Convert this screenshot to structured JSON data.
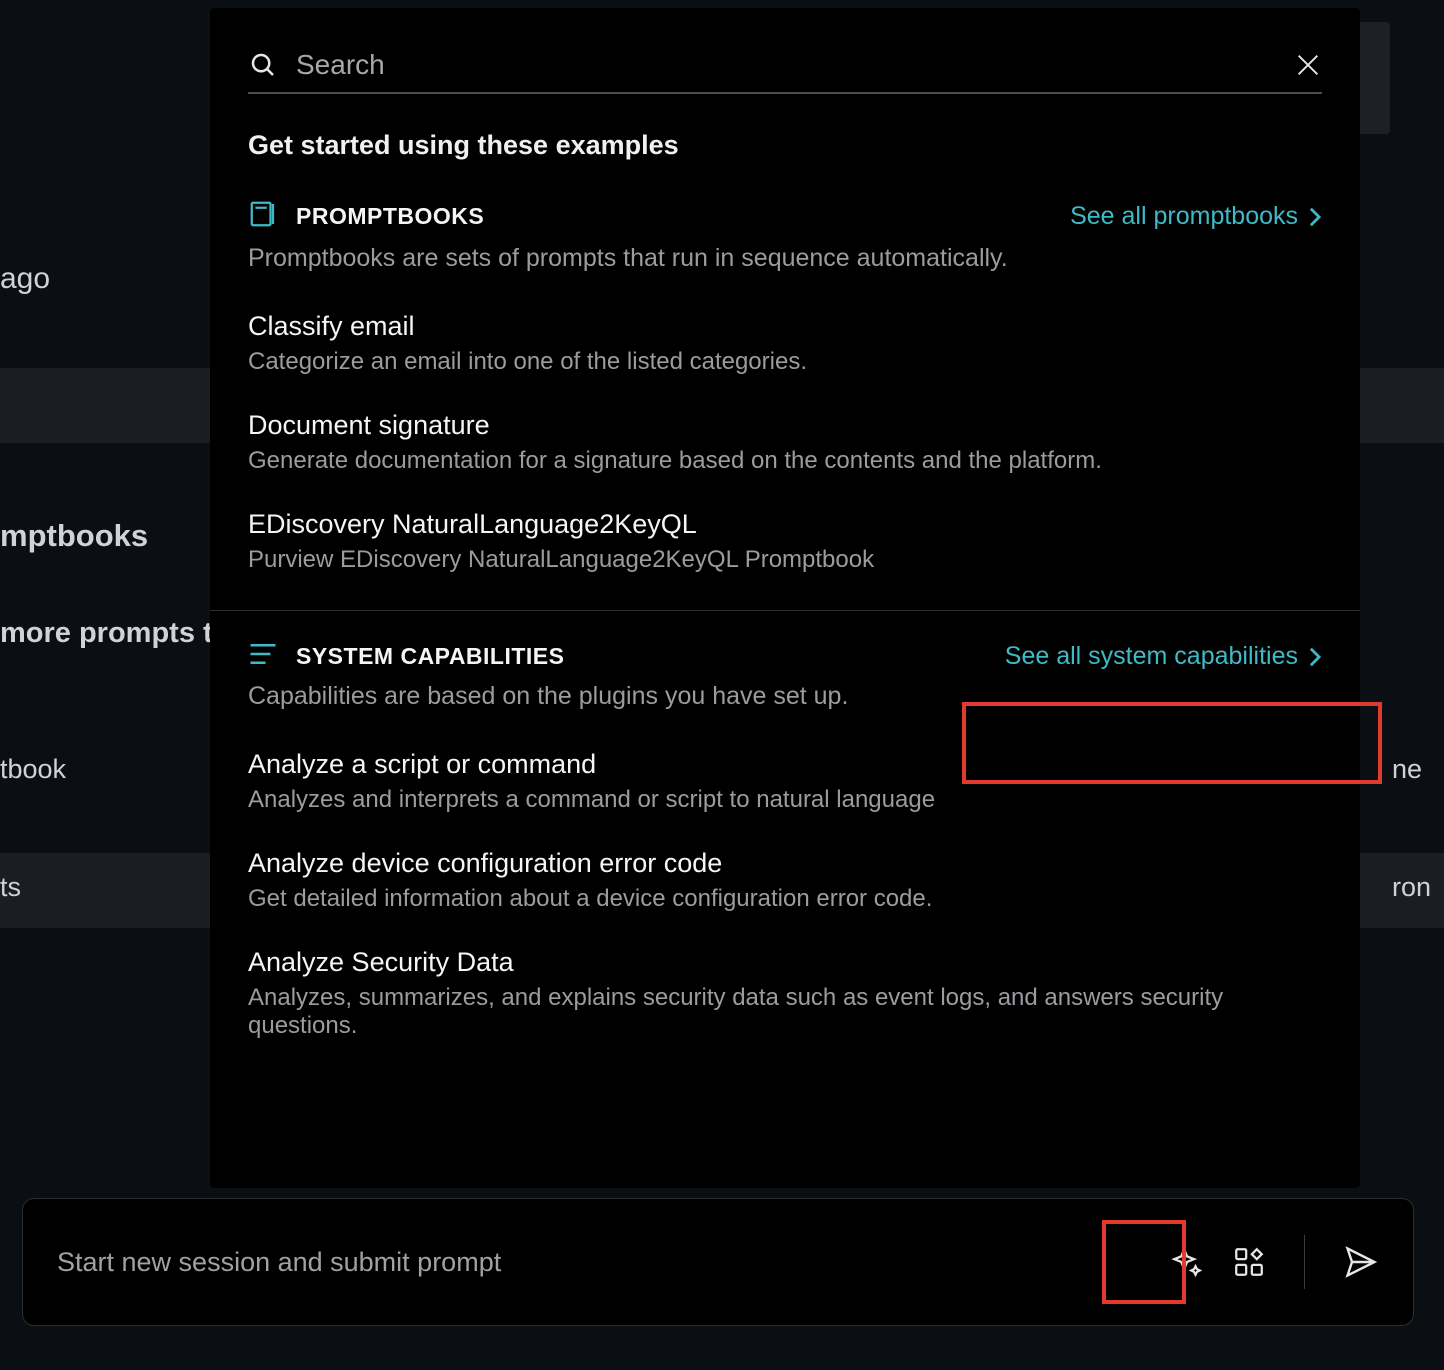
{
  "background": {
    "ago": "ago",
    "mptbooks": "mptbooks",
    "more_prompts": "more prompts th",
    "tbook": "tbook",
    "ts": "ts",
    "ne": "ne",
    "ron": "ron"
  },
  "search": {
    "placeholder": "Search"
  },
  "header": {
    "title": "Get started using these examples"
  },
  "promptbooks": {
    "label": "PROMPTBOOKS",
    "see_all": "See all promptbooks",
    "desc": "Promptbooks are sets of prompts that run in sequence automatically.",
    "items": [
      {
        "title": "Classify email",
        "desc": "Categorize an email into one of the listed categories."
      },
      {
        "title": "Document signature",
        "desc": "Generate documentation for a signature based on the contents and the platform."
      },
      {
        "title": "EDiscovery NaturalLanguage2KeyQL",
        "desc": "Purview EDiscovery NaturalLanguage2KeyQL Promptbook"
      }
    ]
  },
  "capabilities": {
    "label": "SYSTEM CAPABILITIES",
    "see_all": "See all system capabilities",
    "desc": "Capabilities are based on the plugins you have set up.",
    "items": [
      {
        "title": "Analyze a script or command",
        "desc": "Analyzes and interprets a command or script to natural language"
      },
      {
        "title": "Analyze device configuration error code",
        "desc": "Get detailed information about a device configuration error code."
      },
      {
        "title": "Analyze Security Data",
        "desc": "Analyzes, summarizes, and explains security data such as event logs, and answers security questions."
      }
    ]
  },
  "input": {
    "placeholder": "Start new session and submit prompt"
  }
}
